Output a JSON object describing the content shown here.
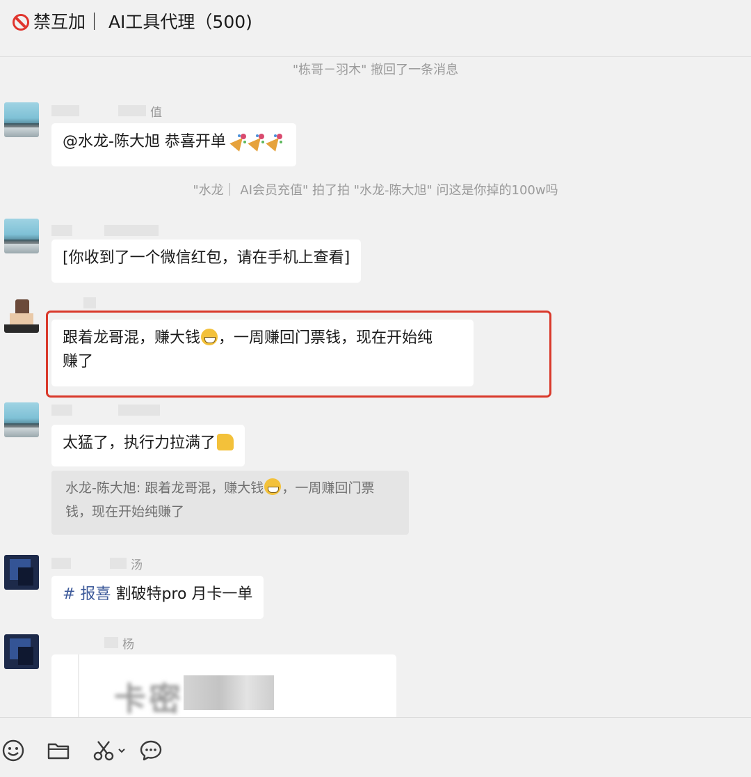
{
  "header": {
    "title": "禁互加｜ AI工具代理（500)"
  },
  "system_messages": [
    "\"栋哥－羽木\" 撤回了一条消息",
    "\"水龙｜ AI会员充值\" 拍了拍 \"水龙-陈大旭\" 问这是你掉的100w吗"
  ],
  "messages": [
    {
      "nick": "值",
      "text": "@水龙-陈大旭 恭喜开单 ",
      "emojis": [
        "party",
        "party",
        "party"
      ]
    },
    {
      "nick": "",
      "text": "[你收到了一个微信红包，请在手机上查看]"
    },
    {
      "nick": "",
      "text_line1_a": "跟着龙哥混，赚大钱",
      "text_line1_b": "，一周赚回门票钱，现在开始纯",
      "text_line2": "赚了",
      "highlighted": true
    },
    {
      "nick": "",
      "text": "太猛了，执行力拉满了",
      "quote_line1_a": "水龙-陈大旭: 跟着龙哥混，赚大钱",
      "quote_line1_b": "，一周赚回门票",
      "quote_line2": "钱，现在开始纯赚了"
    },
    {
      "nick": "汤",
      "tag": "# 报喜",
      "text": "割破特pro 月卡一单"
    },
    {
      "nick": "杨",
      "card_text": "卡密"
    }
  ],
  "toolbar": {
    "icons": [
      "emoji-icon",
      "folder-icon",
      "scissors-icon",
      "chat-history-icon"
    ]
  },
  "colors": {
    "highlight_border": "#d9392b",
    "tag_color": "#3d5a9a",
    "background": "#f1f1f1"
  }
}
